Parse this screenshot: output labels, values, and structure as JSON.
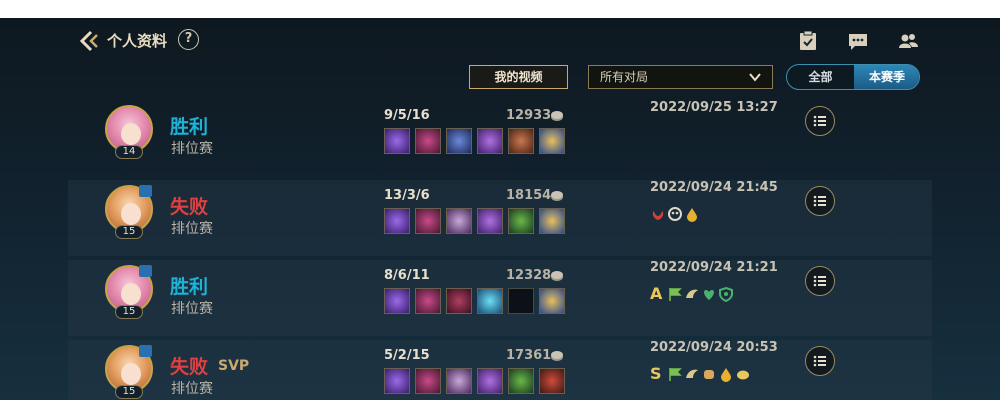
{
  "header": {
    "title": "个人资料",
    "help_label": "?",
    "icons": [
      "back-icon",
      "help-icon",
      "mission-icon",
      "chat-icon",
      "friends-icon"
    ]
  },
  "filters": {
    "my_videos_label": "我的视频",
    "match_type_selected": "所有对局",
    "season_toggle": {
      "all_label": "全部",
      "season_label": "本赛季",
      "active": "本赛季"
    }
  },
  "colors": {
    "win": "#1fb2d6",
    "loss": "#e23f3f",
    "gold_accent": "#c8aa6e",
    "toggle_active": "#2f86b8"
  },
  "matches": [
    {
      "result": "胜利",
      "outcome": "win",
      "svp": "",
      "mode": "排位赛",
      "level": "14",
      "kda": "9/5/16",
      "gold": "12933",
      "date": "2022/09/25 13:27",
      "items": [
        "purple",
        "crimson",
        "indigo",
        "violet",
        "brown",
        "gold"
      ],
      "badges": []
    },
    {
      "result": "失败",
      "outcome": "loss",
      "svp": "",
      "mode": "排位赛",
      "level": "15",
      "kda": "13/3/6",
      "gold": "18154",
      "date": "2022/09/24 21:45",
      "items": [
        "purple",
        "crimson",
        "steel",
        "violet",
        "green",
        "gold"
      ],
      "badges": [
        {
          "name": "lotus-badge-icon",
          "color": "#d0403a"
        },
        {
          "name": "skull-badge-icon",
          "color": "#e0d8c8"
        },
        {
          "name": "drop-badge-icon",
          "color": "#e8b030"
        }
      ]
    },
    {
      "result": "胜利",
      "outcome": "win",
      "svp": "",
      "mode": "排位赛",
      "level": "15",
      "kda": "8/6/11",
      "gold": "12328",
      "date": "2022/09/24 21:21",
      "items": [
        "purple",
        "crimson",
        "maroon",
        "cyan",
        "empty",
        "gold"
      ],
      "badges": [
        {
          "name": "grade-a-badge",
          "letter": "A",
          "color": "#e8c85a"
        },
        {
          "name": "flag-badge-icon",
          "color": "#7ac050"
        },
        {
          "name": "wing-badge-icon",
          "color": "#d8c890"
        },
        {
          "name": "heart-badge-icon",
          "color": "#4ab070"
        },
        {
          "name": "shield-badge-icon",
          "color": "#4ab070"
        }
      ]
    },
    {
      "result": "失败",
      "outcome": "loss",
      "svp": "SVP",
      "mode": "排位赛",
      "level": "15",
      "kda": "5/2/15",
      "gold": "17361",
      "date": "2022/09/24 20:53",
      "items": [
        "purple",
        "crimson",
        "steel",
        "violet",
        "green",
        "red"
      ],
      "badges": [
        {
          "name": "grade-s-badge",
          "letter": "S",
          "color": "#e8c85a"
        },
        {
          "name": "flag-badge-icon",
          "color": "#7ac050"
        },
        {
          "name": "wing-badge-icon",
          "color": "#d8c890"
        },
        {
          "name": "fist-badge-icon",
          "color": "#d8a860"
        },
        {
          "name": "drop-badge-icon",
          "color": "#e8b030"
        },
        {
          "name": "coin-badge-icon",
          "color": "#e8c85a"
        }
      ]
    }
  ]
}
